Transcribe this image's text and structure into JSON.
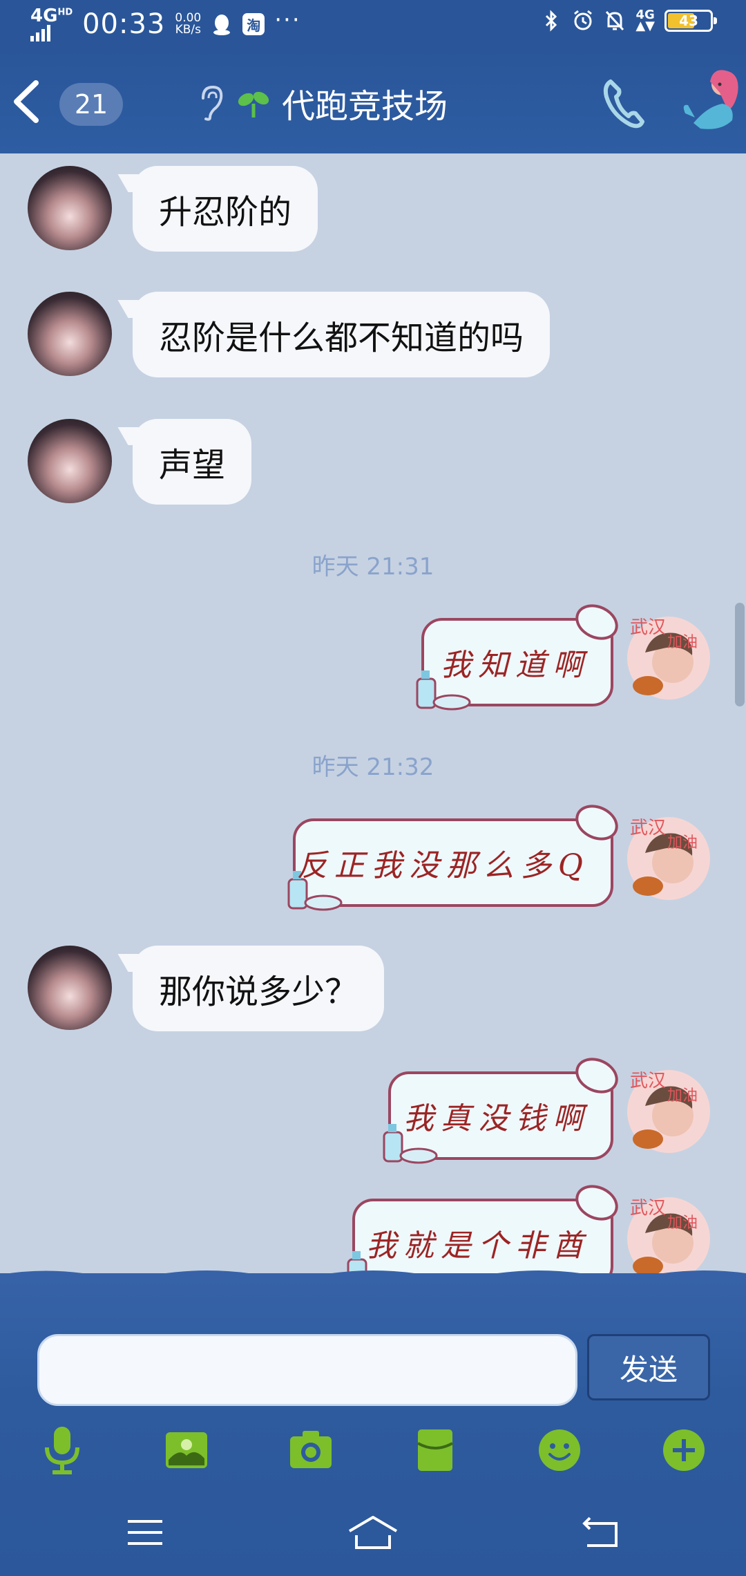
{
  "status_bar": {
    "network": "4G",
    "network_sup": "HD",
    "time": "00:33",
    "speed_value": "0.00",
    "speed_unit": "KB/s",
    "taobao_label": "淘",
    "more": "···",
    "cell": "4G",
    "battery": "43"
  },
  "header": {
    "unread_count": "21",
    "title": "代跑竞技场"
  },
  "messages": [
    {
      "side": "in",
      "text": "升忍阶的"
    },
    {
      "side": "in",
      "text": "忍阶是什么都不知道的吗"
    },
    {
      "side": "in",
      "text": "声望"
    },
    {
      "type": "time",
      "text": "昨天 21:31"
    },
    {
      "side": "out",
      "sticker_text": "我知道啊"
    },
    {
      "type": "time",
      "text": "昨天 21:32"
    },
    {
      "side": "out",
      "sticker_text": "反正我没那么多Q"
    },
    {
      "side": "in",
      "text": "那你说多少？"
    },
    {
      "side": "out",
      "sticker_text": "我真没钱啊"
    },
    {
      "side": "out",
      "sticker_text": "我就是个非酋"
    }
  ],
  "input": {
    "value": "",
    "send_label": "发送"
  },
  "toolbar": [
    "mic-icon",
    "image-icon",
    "camera-icon",
    "red-packet-icon",
    "emoji-icon",
    "plus-icon"
  ],
  "colors": {
    "header_blue": "#2a5699",
    "chat_bg": "#c6d2e2",
    "tool_green": "#7cbf2b",
    "sticker_text": "#9c2424"
  }
}
